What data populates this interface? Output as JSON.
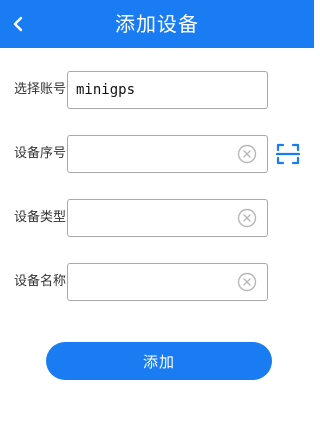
{
  "header": {
    "title": "添加设备",
    "back_icon": "chevron-left-icon"
  },
  "form": {
    "account": {
      "label": "选择账号",
      "value": "minigps"
    },
    "serial": {
      "label": "设备序号",
      "value": "",
      "clear_icon": "clear-circle-icon",
      "scan_icon": "scan-icon"
    },
    "type": {
      "label": "设备类型",
      "value": "",
      "clear_icon": "clear-circle-icon"
    },
    "name": {
      "label": "设备名称",
      "value": "",
      "clear_icon": "clear-circle-icon"
    }
  },
  "submit": {
    "label": "添加"
  },
  "colors": {
    "primary": "#1a7cf2",
    "border": "#a9a9a9",
    "icon_gray": "#b8b8b8"
  }
}
